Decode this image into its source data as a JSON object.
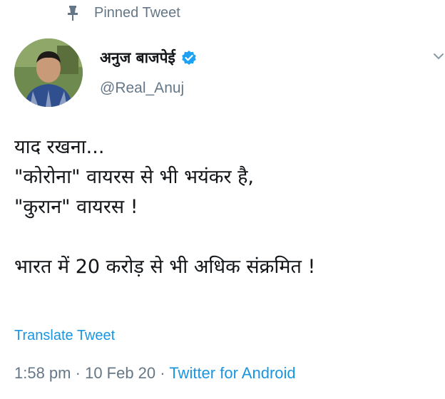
{
  "pinned": {
    "label": "Pinned Tweet",
    "icon": "pin-icon"
  },
  "author": {
    "display_name": "अनुज बाजपेई",
    "handle": "@Real_Anuj",
    "verified": true,
    "verified_icon": "verified-badge-icon",
    "avatar_icon": "avatar-photo"
  },
  "tweet": {
    "lines": [
      "याद रखना...",
      "\"कोरोना\" वायरस से भी भयंकर है,",
      "\"कुरान\" वायरस !",
      "भारत में 20 करोड़ से भी अधिक संक्रमित !"
    ],
    "translate_label": "Translate Tweet",
    "time": "1:58 pm",
    "date": "10 Feb 20",
    "separator": "·",
    "source": "Twitter for Android"
  },
  "menu_icon": "chevron-down-icon",
  "colors": {
    "text": "#14171a",
    "muted": "#657786",
    "link": "#1b95e0",
    "verified": "#1da1f2"
  }
}
